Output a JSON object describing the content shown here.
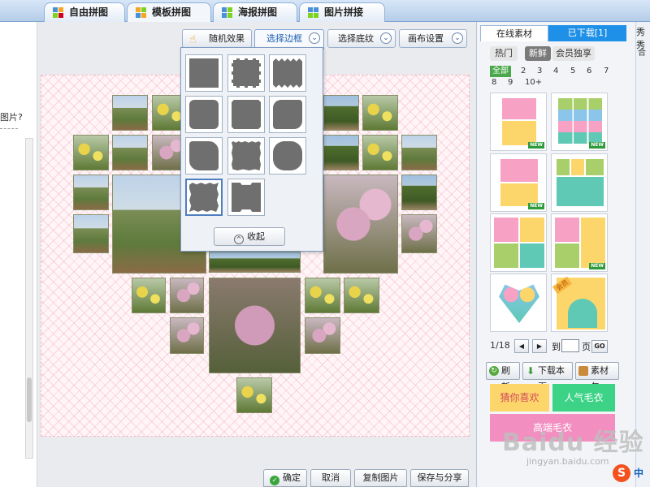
{
  "top_tabs": [
    {
      "label": "自由拼图",
      "active": false
    },
    {
      "label": "模板拼图",
      "active": true
    },
    {
      "label": "海报拼图",
      "active": false
    },
    {
      "label": "图片拼接",
      "active": false
    }
  ],
  "left_panel": {
    "question_text": "图片?"
  },
  "toolbar": {
    "random_effect": "随机效果",
    "choose_border": "选择边框",
    "choose_texture": "选择底纹",
    "canvas_settings": "画布设置"
  },
  "border_popup": {
    "collapse_label": "收起",
    "selected_index": 9
  },
  "bottom_buttons": {
    "confirm": "确定",
    "cancel": "取消",
    "copy_image": "复制图片",
    "save_share": "保存与分享"
  },
  "right_panel": {
    "tab_online": "在线素材",
    "tab_downloaded": "已下载[1]",
    "filters": {
      "hot": "热门",
      "new": "新鲜",
      "vip": "会员独享"
    },
    "counts_all": "全部",
    "counts": [
      "2",
      "3",
      "4",
      "5",
      "6",
      "7",
      "8",
      "9",
      "10+"
    ],
    "new_badge": "NEW",
    "vip_badge": "会员",
    "pager": {
      "current": "1/18",
      "goto_label": "到",
      "page_label": "页",
      "go": "GO"
    },
    "actions": {
      "refresh": "刷新",
      "download_page": "下载本页",
      "material_pack": "素材包"
    },
    "promos": {
      "guess": "猜你喜欢",
      "popular": "人气毛衣",
      "high_end": "高端毛衣"
    }
  },
  "far_right": {
    "title_fragment": "秀秀",
    "sub_fragment": "合"
  },
  "overlay": {
    "watermark": "Baidu 经验",
    "watermark_url": "jingyan.baidu.com",
    "sogou_text": "中"
  },
  "colors": {
    "accent_blue": "#1e90e8",
    "selected_green": "#4aa84a",
    "tpl_pink": "#f7a1c4",
    "tpl_yellow": "#fdd66b",
    "tpl_green": "#a9cf6a",
    "tpl_teal": "#5fc9b6",
    "tpl_blue": "#8bc5ea"
  },
  "icons": [
    "hand-pointer-icon",
    "chevron-down-icon",
    "chevron-up-icon",
    "check-icon",
    "refresh-icon",
    "download-icon",
    "package-icon",
    "arrow-left-icon",
    "arrow-right-icon"
  ]
}
